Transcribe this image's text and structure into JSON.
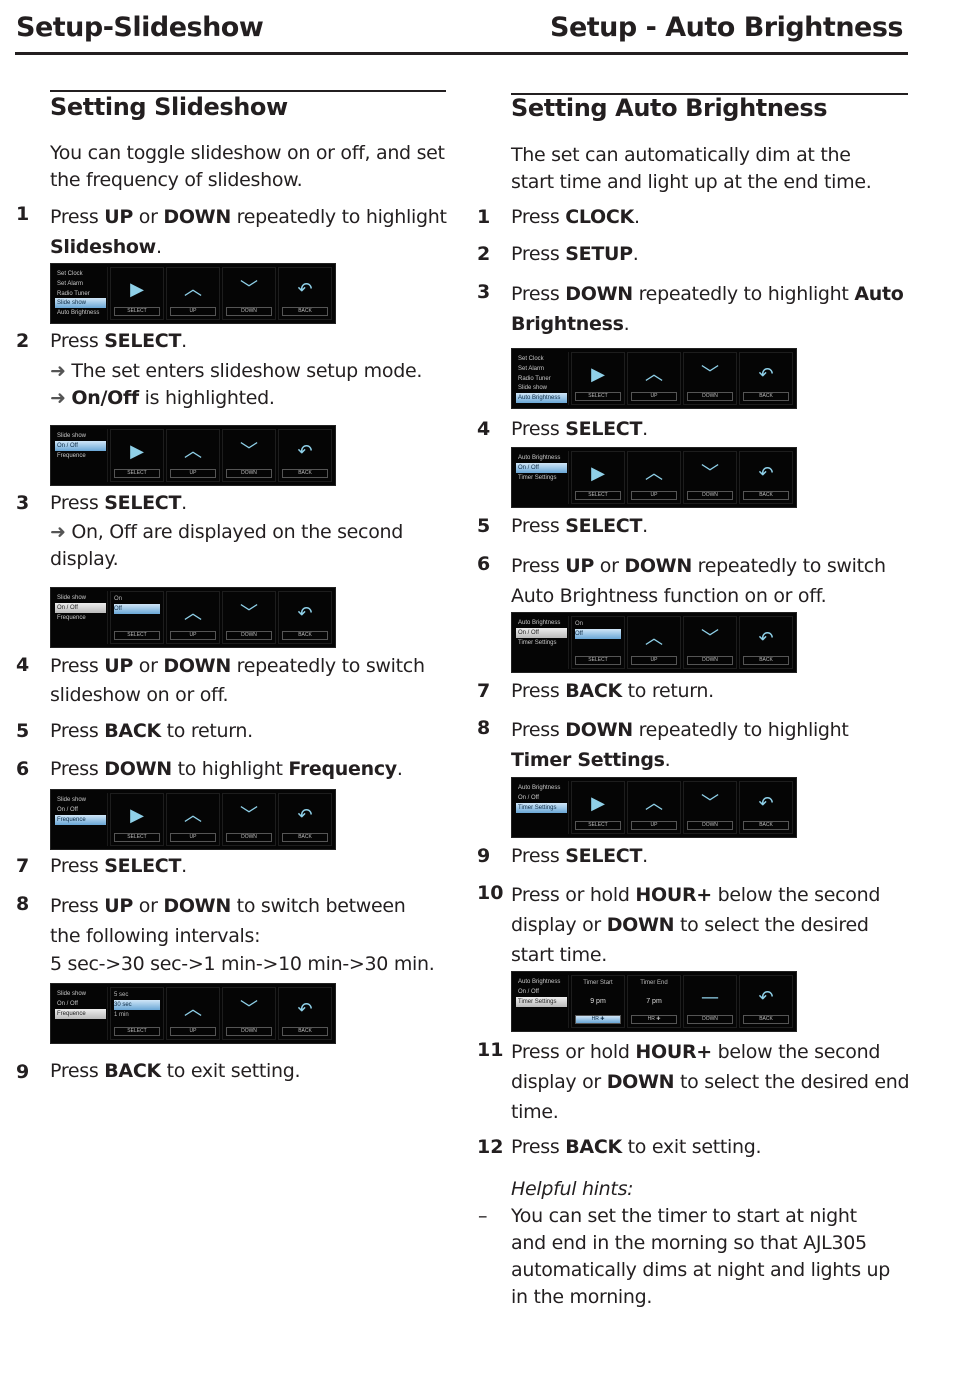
{
  "header": {
    "left_title": "Setup-Slideshow",
    "right_title": "Setup - Auto Brightness"
  },
  "icons": {
    "select": "▶",
    "up": "︿",
    "down": "﹀",
    "back": "↶",
    "dash": "—",
    "arrow": "➜"
  },
  "buttons": {
    "select": "SELECT",
    "up": "UP",
    "down": "DOWN",
    "back": "BACK",
    "hour": "HR ✚"
  },
  "slideshow": {
    "title": "Setting Slideshow",
    "intro": "You can toggle slideshow on or off, and set the frequency of slideshow.",
    "steps": [
      {
        "n": "1",
        "pre": "Press ",
        "b1": "UP",
        "mid": " or ",
        "b2": "DOWN",
        "post": " repeatedly to highlight ",
        "b3": "Slideshow",
        "end": "."
      },
      {
        "n": "2",
        "pre": "Press ",
        "b1": "SELECT",
        "end": ".",
        "sub1": "The set enters slideshow setup mode.",
        "sub2b": "On/Off",
        "sub2": " is highlighted."
      },
      {
        "n": "3",
        "pre": "Press ",
        "b1": "SELECT",
        "end": ".",
        "sub1": "On, Off are displayed on the second display."
      },
      {
        "n": "4",
        "pre": "Press ",
        "b1": "UP",
        "mid": " or ",
        "b2": "DOWN",
        "post": " repeatedly to switch slideshow on or off."
      },
      {
        "n": "5",
        "pre": "Press ",
        "b1": "BACK",
        "post": " to return."
      },
      {
        "n": "6",
        "pre": "Press ",
        "b1": "DOWN",
        "post": " to highlight ",
        "b3": "Frequency",
        "end": "."
      },
      {
        "n": "7",
        "pre": "Press ",
        "b1": "SELECT",
        "end": "."
      },
      {
        "n": "8",
        "pre": "Press ",
        "b1": "UP",
        "mid": " or ",
        "b2": "DOWN",
        "post": " to switch between the following intervals:",
        "sub1": "5 sec->30 sec->1 min->10 min->30 min."
      },
      {
        "n": "9",
        "pre": "Press ",
        "b1": "BACK",
        "post": " to exit setting."
      }
    ],
    "screens": {
      "main_menu": [
        "Set Clock",
        "Set Alarm",
        "Radio Tuner",
        "Slide show",
        "Auto Brightness"
      ],
      "sub_menu": [
        "Slide show",
        "On / Off",
        "Frequence"
      ],
      "onoff_opts": [
        "On",
        "Off"
      ],
      "freq_opts": [
        "5 sec",
        "30 sec",
        "1 min"
      ]
    }
  },
  "brightness": {
    "title": "Setting Auto Brightness",
    "intro": "The set can automatically dim at the start time and light up at the end time.",
    "steps": [
      {
        "n": "1",
        "pre": "Press ",
        "b1": "CLOCK",
        "end": "."
      },
      {
        "n": "2",
        "pre": "Press ",
        "b1": "SETUP",
        "end": "."
      },
      {
        "n": "3",
        "pre": "Press ",
        "b1": "DOWN",
        "post": " repeatedly to highlight ",
        "b3": "Auto Brightness",
        "end": "."
      },
      {
        "n": "4",
        "pre": "Press ",
        "b1": "SELECT",
        "end": "."
      },
      {
        "n": "5",
        "pre": "Press ",
        "b1": "SELECT",
        "end": "."
      },
      {
        "n": "6",
        "pre": "Press ",
        "b1": "UP",
        "mid": " or ",
        "b2": "DOWN",
        "post": " repeatedly to switch Auto Brightness function on or off."
      },
      {
        "n": "7",
        "pre": "Press ",
        "b1": "BACK",
        "post": " to return."
      },
      {
        "n": "8",
        "pre": "Press ",
        "b1": "DOWN",
        "post": " repeatedly to highlight ",
        "b3": "Timer Settings",
        "end": "."
      },
      {
        "n": "9",
        "pre": "Press ",
        "b1": "SELECT",
        "end": "."
      },
      {
        "n": "10",
        "pre": "Press or hold ",
        "b1": "HOUR+",
        "mid": " below the second display or ",
        "b2": "DOWN",
        "post": " to select the desired start time."
      },
      {
        "n": "11",
        "pre": "Press or hold ",
        "b1": "HOUR+",
        "mid": " below the second display or ",
        "b2": "DOWN",
        "post": " to select the desired end time."
      },
      {
        "n": "12",
        "pre": "Press ",
        "b1": "BACK",
        "post": " to exit setting."
      }
    ],
    "screens": {
      "main_menu": [
        "Set Clock",
        "Set Alarm",
        "Radio Tuner",
        "Slide show",
        "Auto Brightness"
      ],
      "sub_menu": [
        "Auto Brightness",
        "On / Off",
        "Timer Settings"
      ],
      "onoff_opts": [
        "On",
        "Off"
      ],
      "timer_start_label": "Timer Start",
      "timer_start_value": "9 pm",
      "timer_end_label": "Timer End",
      "timer_end_value": "7 pm"
    },
    "hints_title": "Helpful hints:",
    "hint_dash": "–",
    "hint_text": "You can set the timer to start at night and end in the morning so that AJL305 automatically dims at night and lights up in the morning."
  }
}
